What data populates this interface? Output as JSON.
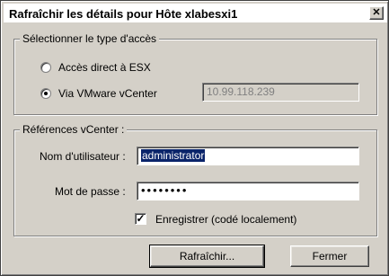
{
  "window": {
    "title": "Rafraîchir les détails pour Hôte xlabesxi1",
    "close_glyph": "✕"
  },
  "access_group": {
    "legend": "Sélectionner le type d'accès",
    "options": [
      {
        "label": "Accès direct à ESX",
        "selected": false
      },
      {
        "label": "Via VMware vCenter",
        "selected": true
      }
    ],
    "vcenter_address": "10.99.118.239"
  },
  "credentials_group": {
    "legend": "Références vCenter :",
    "username_label": "Nom d'utilisateur :",
    "username_value": "administrator",
    "password_label": "Mot de passe :",
    "password_value": "••••••••",
    "save_label": "Enregistrer (codé localement)",
    "save_checked": true,
    "check_glyph": "✓"
  },
  "buttons": {
    "refresh": "Rafraîchir...",
    "close": "Fermer"
  }
}
